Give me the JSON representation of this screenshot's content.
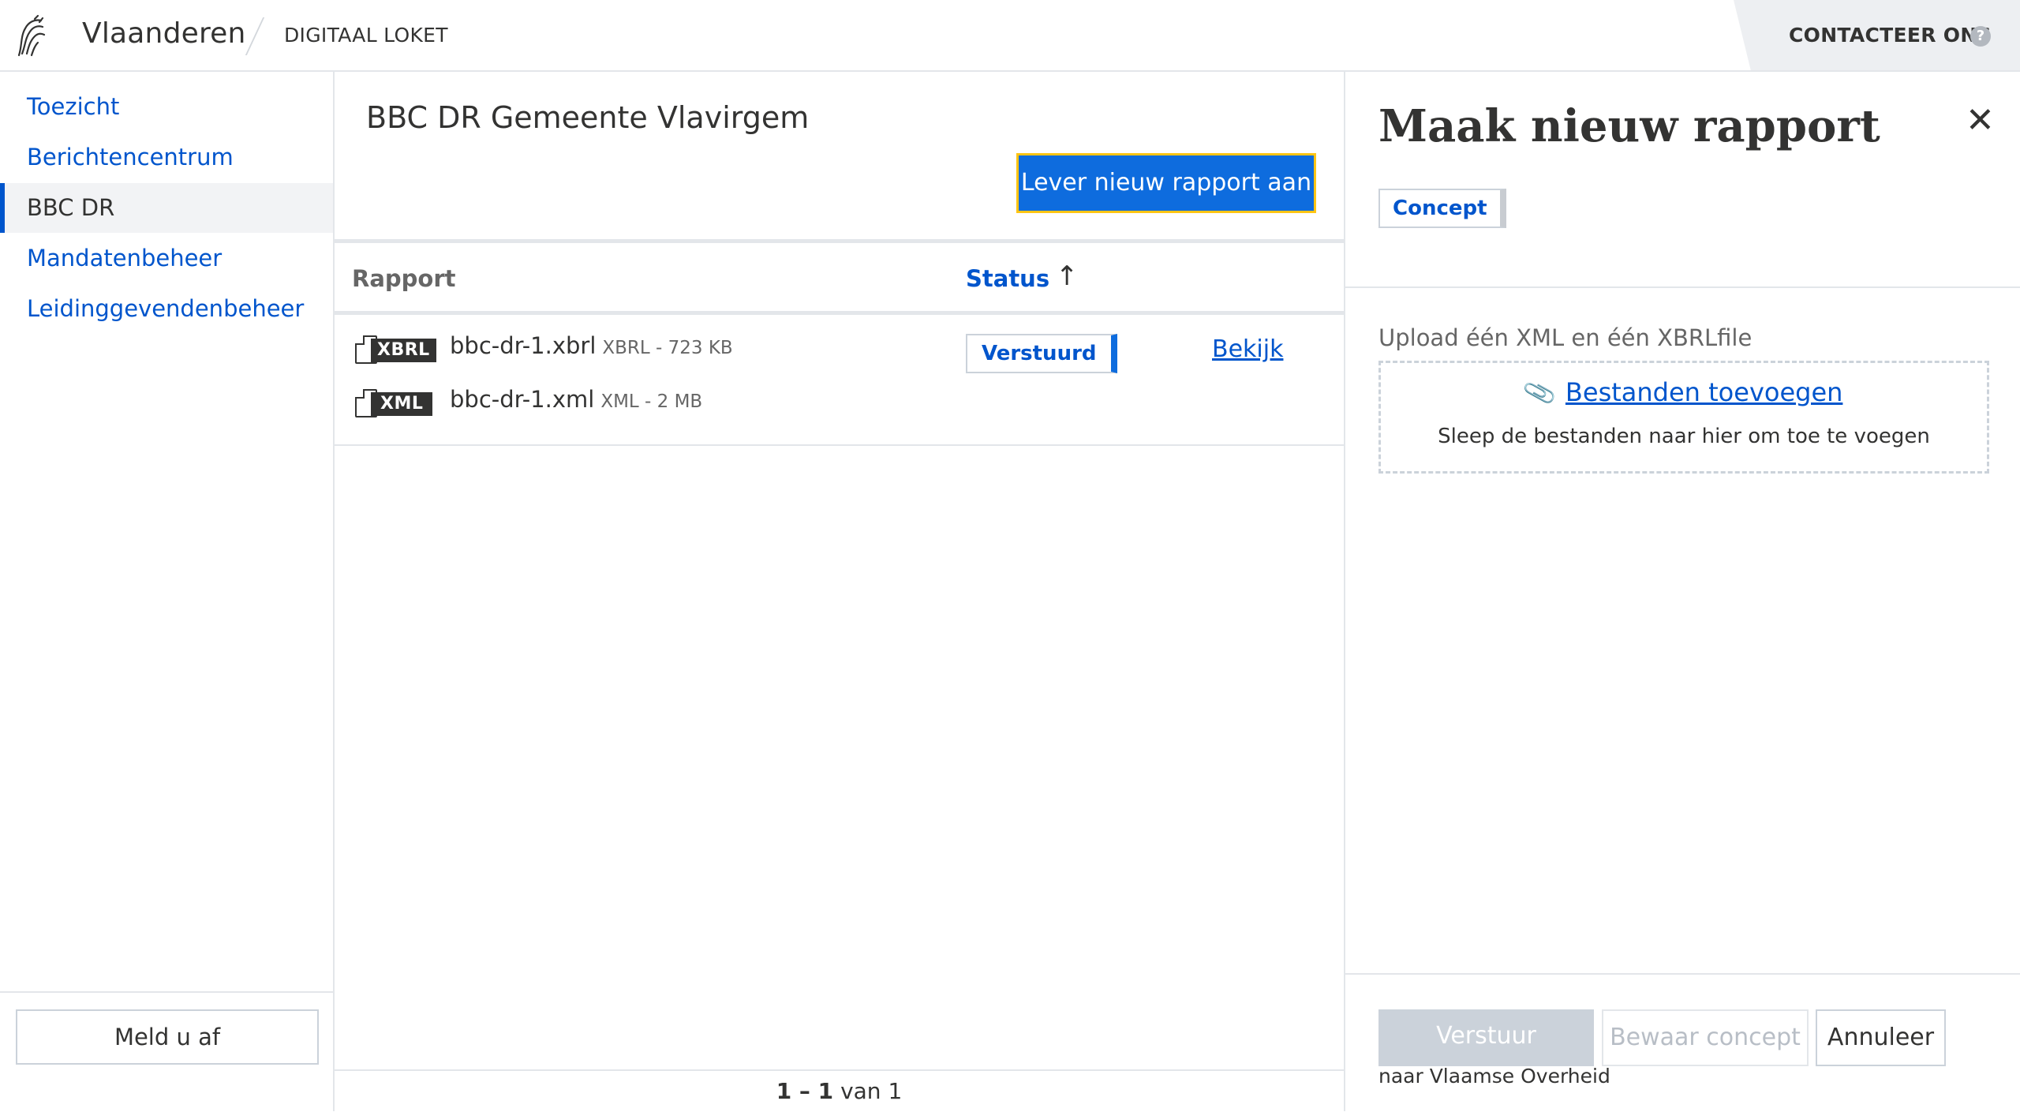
{
  "header": {
    "brand": "Vlaanderen",
    "app_name": "DIGITAAL LOKET",
    "contact_label": "CONTACTEER ONS",
    "help_glyph": "?"
  },
  "sidebar": {
    "items": [
      {
        "label": "Toezicht",
        "active": false
      },
      {
        "label": "Berichtencentrum",
        "active": false
      },
      {
        "label": "BBC DR",
        "active": true
      },
      {
        "label": "Mandatenbeheer",
        "active": false
      },
      {
        "label": "Leidinggevendenbeheer",
        "active": false
      }
    ],
    "logout_label": "Meld u af"
  },
  "main": {
    "title": "BBC DR Gemeente Vlavirgem",
    "new_report_button": "Lever nieuw rapport aan",
    "table": {
      "columns": {
        "rapport": "Rapport",
        "status": "Status"
      },
      "sort_icon": "↑",
      "rows": [
        {
          "files": [
            {
              "tag": "XBRL",
              "name": "bbc-dr-1.xbrl",
              "meta": "XBRL - 723 KB"
            },
            {
              "tag": "XML",
              "name": "bbc-dr-1.xml",
              "meta": "XML - 2 MB"
            }
          ],
          "status": "Verstuurd",
          "action": "Bekijk"
        }
      ]
    },
    "pagination": {
      "range": "1 – 1",
      "suffix": "van 1"
    }
  },
  "panel": {
    "title": "Maak nieuw rapport",
    "close_glyph": "✕",
    "status": "Concept",
    "upload_label": "Upload één XML en één XBRLfile",
    "add_files_link": "Bestanden toevoegen",
    "dropzone_hint": "Sleep de bestanden naar hier om toe te voegen",
    "send_button": "Verstuur",
    "save_button": "Bewaar concept",
    "cancel_button": "Annuleer",
    "send_subtext": "naar Vlaamse Overheid"
  },
  "colors": {
    "link_blue": "#0055cc",
    "primary_blue": "#0e6cde",
    "focus_yellow": "#ffc515",
    "text": "#333332",
    "border": "#e3e6ea"
  }
}
